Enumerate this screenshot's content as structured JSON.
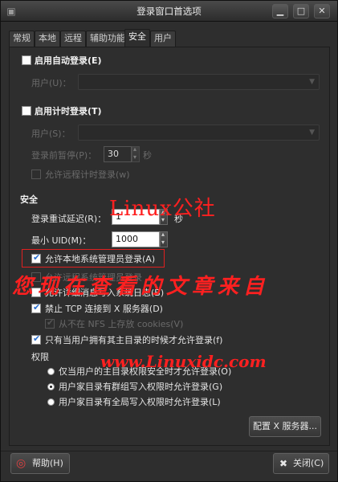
{
  "window": {
    "title": "登录窗口首选项"
  },
  "titlebar_buttons": {
    "minimize": "▁",
    "maximize": "□",
    "close": "✕"
  },
  "tabs": [
    {
      "label": "常规"
    },
    {
      "label": "本地"
    },
    {
      "label": "远程"
    },
    {
      "label": "辅助功能"
    },
    {
      "label": "安全"
    },
    {
      "label": "用户"
    }
  ],
  "active_tab": "安全",
  "autologin": {
    "checkbox_label": "启用自动登录(E)",
    "checked": false,
    "user_label": "用户(U)："
  },
  "timed_login": {
    "checkbox_label": "启用计时登录(T)",
    "checked": false,
    "user_label": "用户(S)：",
    "pause_label": "登录前暂停(P)：",
    "pause_value": "30",
    "pause_unit": "秒",
    "remote_label": "允许远程计时登录(w)"
  },
  "security": {
    "heading": "安全",
    "retry_label": "登录重试延迟(R)：",
    "retry_value": "1",
    "retry_unit": "秒",
    "min_uid_label": "最小 UID(M)：",
    "min_uid_value": "1000",
    "options": [
      {
        "label": "允许本地系统管理员登录(A)",
        "checked": true,
        "enabled": true
      },
      {
        "label": "允许远程系统管理员登录",
        "checked": false,
        "enabled": false
      },
      {
        "label": "允许详细消息写入系统日志(B)",
        "checked": false,
        "enabled": true
      },
      {
        "label": "禁止 TCP 连接到 X 服务器(D)",
        "checked": true,
        "enabled": true
      },
      {
        "label": "从不在 NFS 上存放 cookies(V)",
        "checked": true,
        "enabled": false
      },
      {
        "label": "只有当用户拥有其主目录的时候才允许登录(f)",
        "checked": true,
        "enabled": true
      }
    ]
  },
  "permissions": {
    "heading": "权限",
    "radios": [
      {
        "label": "仅当用户的主目录权限安全时才允许登录(O)",
        "selected": false
      },
      {
        "label": "用户家目录有群组写入权限时允许登录(G)",
        "selected": true
      },
      {
        "label": "用户家目录有全局写入权限时允许登录(L)",
        "selected": false
      }
    ]
  },
  "configure_button": "配置 X 服务器...",
  "footer": {
    "help_label": "帮助(H)",
    "close_label": "关闭(C)"
  },
  "watermark": {
    "line1": "Linux公社",
    "line2": "您现在查看的文章来自",
    "line3": "www.Linuxidc.com"
  },
  "colors": {
    "watermark": "#ff2020",
    "highlight_box": "#e02020",
    "accent": "#2a6fd0"
  }
}
